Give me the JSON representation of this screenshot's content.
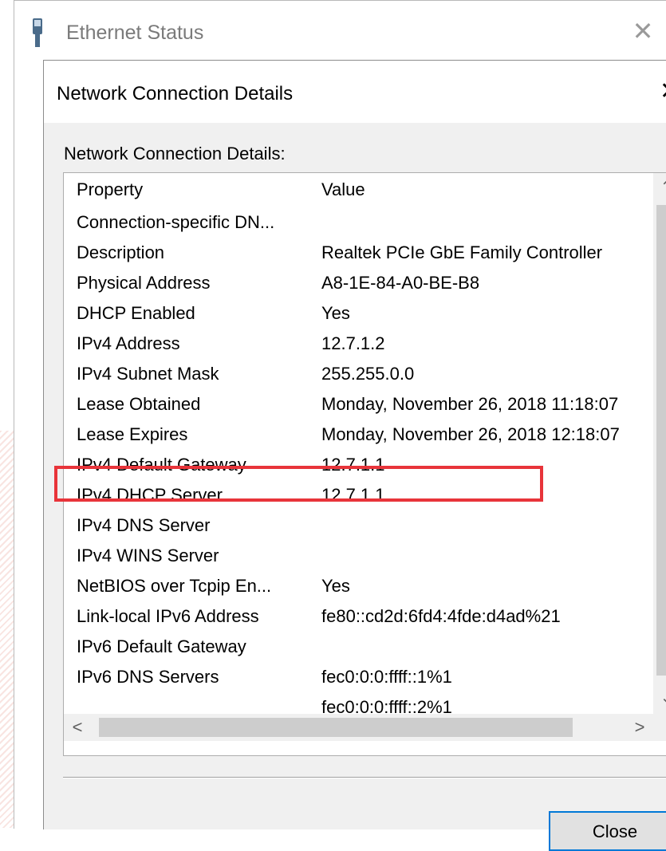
{
  "outer_window": {
    "title": "Ethernet Status",
    "close_glyph": "✕"
  },
  "dialog": {
    "title": "Network Connection Details",
    "close_glyph": "✕",
    "group_label": "Network Connection Details:",
    "columns": {
      "property": "Property",
      "value": "Value"
    },
    "rows": [
      {
        "property": "Connection-specific DN...",
        "value": ""
      },
      {
        "property": "Description",
        "value": "Realtek PCIe GbE Family Controller"
      },
      {
        "property": "Physical Address",
        "value": "A8-1E-84-A0-BE-B8"
      },
      {
        "property": "DHCP Enabled",
        "value": "Yes"
      },
      {
        "property": "IPv4 Address",
        "value": "12.7.1.2"
      },
      {
        "property": "IPv4 Subnet Mask",
        "value": "255.255.0.0"
      },
      {
        "property": "Lease Obtained",
        "value": "Monday, November 26, 2018 11:18:07"
      },
      {
        "property": "Lease Expires",
        "value": "Monday, November 26, 2018 12:18:07"
      },
      {
        "property": "IPv4 Default Gateway",
        "value": "12.7.1.1"
      },
      {
        "property": "IPv4 DHCP Server",
        "value": "12.7.1.1"
      },
      {
        "property": "IPv4 DNS Server",
        "value": ""
      },
      {
        "property": "IPv4 WINS Server",
        "value": ""
      },
      {
        "property": "NetBIOS over Tcpip En...",
        "value": "Yes"
      },
      {
        "property": "Link-local IPv6 Address",
        "value": "fe80::cd2d:6fd4:4fde:d4ad%21"
      },
      {
        "property": "IPv6 Default Gateway",
        "value": ""
      },
      {
        "property": "IPv6 DNS Servers",
        "value": "fec0:0:0:ffff::1%1"
      },
      {
        "property": "",
        "value": "fec0:0:0:ffff::2%1"
      }
    ],
    "scroll_glyphs": {
      "up": "⌃",
      "down": "⌄",
      "left": "<",
      "right": ">"
    },
    "close_button": "Close"
  },
  "annotation": {
    "highlight_color": "#e8343a"
  }
}
